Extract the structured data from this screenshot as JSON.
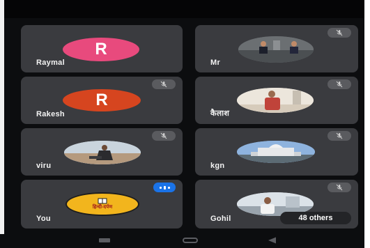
{
  "participants": [
    {
      "name": "Raymal",
      "avatar_type": "initial",
      "initial": "R",
      "avatar_color": "#e84a7d",
      "muted": false
    },
    {
      "name": "Mr",
      "avatar_type": "photo",
      "muted": true
    },
    {
      "name": "Rakesh",
      "avatar_type": "initial",
      "initial": "R",
      "avatar_color": "#d6451f",
      "muted": true
    },
    {
      "name": "कैलाश",
      "avatar_type": "photo",
      "muted": true
    },
    {
      "name": "viru",
      "avatar_type": "photo",
      "muted": true
    },
    {
      "name": "kgn",
      "avatar_type": "photo",
      "muted": true
    },
    {
      "name": "You",
      "avatar_type": "logo",
      "logo_text": "हिन्दी-दर्पण",
      "avatar_color": "#f2b51d",
      "speaking": true
    },
    {
      "name": "Gohil",
      "avatar_type": "photo",
      "muted": true
    }
  ],
  "others_label": "48 others",
  "icons": {
    "mute": "mic-off-icon",
    "speaking": "audio-levels-icon",
    "nav_back": "back-triangle-icon",
    "nav_home": "home-pill-icon",
    "nav_recent": "recent-apps-icon"
  },
  "colors": {
    "background": "#0c0d0f",
    "tile": "#3a3b3f",
    "mute_badge": "#5a5b5f",
    "speaking_badge": "#1a73e8"
  }
}
